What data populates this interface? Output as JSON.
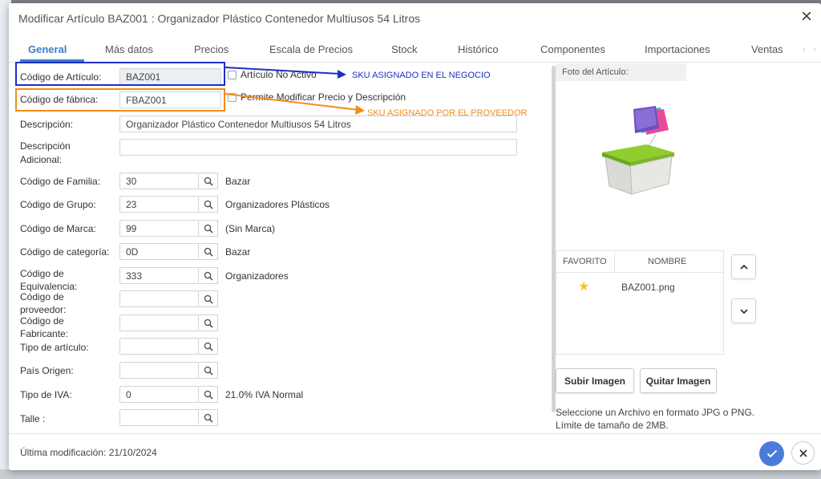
{
  "modal": {
    "title": "Modificar Artículo BAZ001 : Organizador Plástico Contenedor Multiusos 54 Litros",
    "close_icon": "close-icon"
  },
  "tabs": [
    {
      "label": "General",
      "active": true
    },
    {
      "label": "Más datos"
    },
    {
      "label": "Precios"
    },
    {
      "label": "Escala de Precios"
    },
    {
      "label": "Stock"
    },
    {
      "label": "Histórico"
    },
    {
      "label": "Componentes"
    },
    {
      "label": "Importaciones"
    },
    {
      "label": "Ventas"
    }
  ],
  "form": {
    "codigo_articulo": {
      "label": "Código de Artículo:",
      "value": "BAZ001"
    },
    "articulo_no_activo": {
      "label": "Artículo No Activo",
      "checked": false
    },
    "codigo_fabrica": {
      "label": "Código de fábrica:",
      "value": "FBAZ001"
    },
    "permite_modificar": {
      "label": "Permite Modificar Precio y Descripción",
      "checked": false
    },
    "descripcion": {
      "label": "Descripción:",
      "value": "Organizador Plástico Contenedor Multiusos 54 Litros"
    },
    "descripcion_adicional": {
      "label_1": "Descripción",
      "label_2": "Adicional:",
      "value": ""
    },
    "familia": {
      "label": "Código de Familia:",
      "value": "30",
      "description": "Bazar"
    },
    "grupo": {
      "label": "Código de Grupo:",
      "value": "23",
      "description": "Organizadores Plásticos"
    },
    "marca": {
      "label": "Código de Marca:",
      "value": "99",
      "description": "(Sin Marca)"
    },
    "categoria": {
      "label": "Código de categoría:",
      "value": "0D",
      "description": "Bazar"
    },
    "equivalencia": {
      "label_1": "Código de",
      "label_2": "Equivalencia:",
      "value": "333",
      "description": "Organizadores"
    },
    "proveedor": {
      "label_1": "Código de",
      "label_2": "proveedor:",
      "value": ""
    },
    "fabricante": {
      "label_1": "Código de",
      "label_2": "Fabricante:",
      "value": ""
    },
    "tipo_articulo": {
      "label": "Tipo de artículo:",
      "value": ""
    },
    "pais_origen": {
      "label": "País Origen:",
      "value": ""
    },
    "tipo_iva": {
      "label": "Tipo de IVA:",
      "value": "0",
      "description": "21.0% IVA Normal"
    },
    "talle": {
      "label": "Talle :",
      "value": ""
    }
  },
  "annotations": {
    "negocio": {
      "text": "SKU ASIGNADO EN EL NEGOCIO",
      "color": "#1f2fc8"
    },
    "proveedor": {
      "text": "SKU ASIGNADO POR EL PROVEEDOR",
      "color": "#f28c1c"
    }
  },
  "photo": {
    "header": "Foto del Artículo:",
    "table_headers": {
      "favorito": "FAVORITO",
      "nombre": "NOMBRE"
    },
    "files": [
      {
        "favorite": true,
        "name": "BAZ001.png"
      }
    ],
    "upload_button": "Subir Imagen",
    "remove_button": "Quitar Imagen",
    "hint": "Seleccione un Archivo en formato JPG o PNG. Límite de tamaño de 2MB."
  },
  "footer": {
    "last_modified": "Última modificación: 21/10/2024"
  },
  "colors": {
    "accent": "#3b7fc4",
    "confirm": "#4a7bdc",
    "star": "#f5c518"
  }
}
